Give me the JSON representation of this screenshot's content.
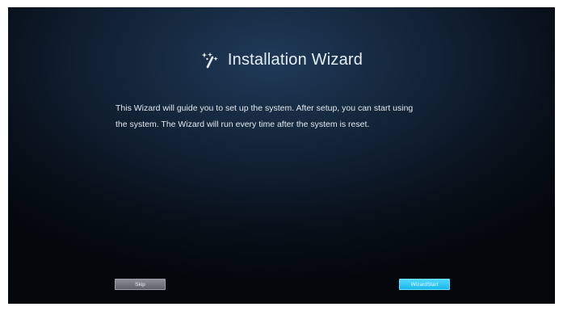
{
  "wizard": {
    "title": "Installation Wizard",
    "icon": "magic-wand-icon",
    "description_lines": [
      "This Wizard will guide you to set up the system. After setup, you can start using",
      "the system. The Wizard will run every time after the system is reset."
    ]
  },
  "buttons": {
    "skip_label": "Skip",
    "start_label": "WizardStart"
  },
  "colors": {
    "accent": "#1ab7ea",
    "background_dark": "#03070c",
    "background_glow": "#1f3a58"
  }
}
